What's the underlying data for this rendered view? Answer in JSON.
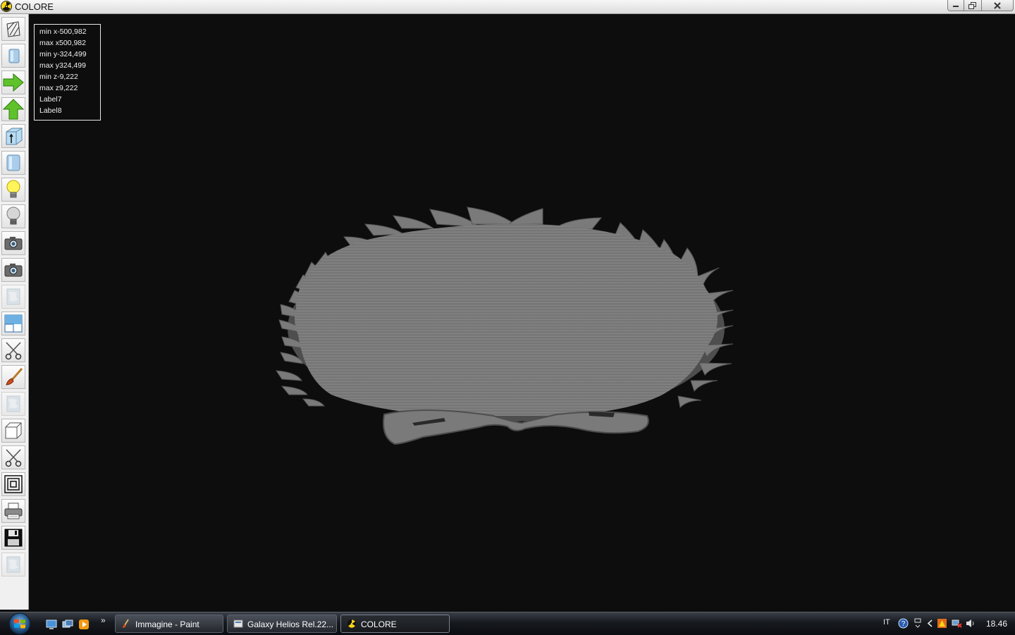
{
  "window": {
    "title": "COLORE"
  },
  "toolbar": {
    "tools": [
      {
        "icon": "wireframe-icon"
      },
      {
        "icon": "solid-view-icon"
      },
      {
        "icon": "arrow-right-icon"
      },
      {
        "icon": "arrow-up-icon"
      },
      {
        "icon": "extrude-icon"
      },
      {
        "icon": "cylinder-view-icon"
      },
      {
        "icon": "light-on-icon"
      },
      {
        "icon": "light-off-icon"
      },
      {
        "icon": "camera-icon"
      },
      {
        "icon": "camera-alt-icon"
      },
      {
        "icon": "texture-icon"
      },
      {
        "icon": "window-frame-icon"
      },
      {
        "icon": "scissors-icon"
      },
      {
        "icon": "brush-icon"
      },
      {
        "icon": "texture-alt-icon"
      },
      {
        "icon": "box-icon"
      },
      {
        "icon": "scissors-alt-icon"
      },
      {
        "icon": "offset-square-icon"
      },
      {
        "icon": "printer-icon"
      },
      {
        "icon": "save-icon"
      },
      {
        "icon": "texture-alt2-icon"
      }
    ]
  },
  "info_panel": {
    "min_x": "min x-500,982",
    "max_x": "max x500,982",
    "min_y": "min y-324,499",
    "max_y": "max y324,499",
    "min_z": "min z-9,222",
    "max_z": "max z9,222",
    "label7": "Label7",
    "label8": "Label8"
  },
  "taskbar": {
    "tasks": [
      {
        "label": "Immagine - Paint",
        "icon": "paint-icon",
        "active": false
      },
      {
        "label": "Galaxy Helios  Rel.22...",
        "icon": "helios-icon",
        "active": false
      },
      {
        "label": "COLORE",
        "icon": "colore-icon",
        "active": true
      }
    ],
    "more": "»",
    "tray": {
      "language": "IT",
      "clock": "18.46"
    }
  },
  "colors": {
    "background": "#0d0d0d",
    "model": "#7a7a7a",
    "model_edge": "#555555"
  }
}
